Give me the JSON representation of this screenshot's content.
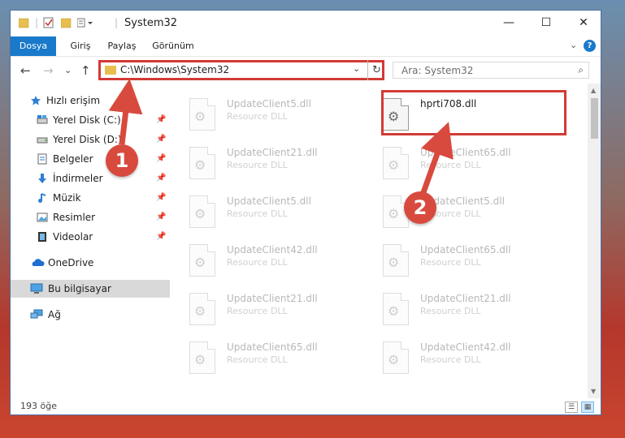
{
  "window": {
    "title": "System32",
    "controls": {
      "minimize": "—",
      "maximize": "☐",
      "close": "✕"
    }
  },
  "ribbon": {
    "tabs": [
      "Dosya",
      "Giriş",
      "Paylaş",
      "Görünüm"
    ],
    "expand_glyph": "⌄",
    "help_glyph": "?"
  },
  "navbar": {
    "back_glyph": "←",
    "forward_glyph": "→",
    "recent_glyph": "⌄",
    "up_glyph": "↑",
    "address": "C:\\Windows\\System32",
    "address_drop_glyph": "⌄",
    "refresh_glyph": "↻",
    "search_placeholder": "Ara: System32",
    "search_glyph": "⌕"
  },
  "sidebar": {
    "items": [
      {
        "label": "Hızlı erişim",
        "icon": "star-icon",
        "pinned": false
      },
      {
        "label": "Yerel Disk (C:)",
        "icon": "drive-icon",
        "pinned": true
      },
      {
        "label": "Yerel Disk (D:)",
        "icon": "drive-icon",
        "pinned": true
      },
      {
        "label": "Belgeler",
        "icon": "documents-icon",
        "pinned": true
      },
      {
        "label": "İndirmeler",
        "icon": "download-icon",
        "pinned": true
      },
      {
        "label": "Müzik",
        "icon": "music-icon",
        "pinned": true
      },
      {
        "label": "Resimler",
        "icon": "pictures-icon",
        "pinned": true
      },
      {
        "label": "Videolar",
        "icon": "videos-icon",
        "pinned": true
      },
      {
        "label": "OneDrive",
        "icon": "cloud-icon",
        "pinned": false
      },
      {
        "label": "Bu bilgisayar",
        "icon": "computer-icon",
        "pinned": false
      },
      {
        "label": "Ağ",
        "icon": "network-icon",
        "pinned": false
      }
    ],
    "pin_glyph": "📌"
  },
  "files": {
    "left_column": [
      {
        "name": "UpdateClient5.dll",
        "desc": "Resource DLL"
      },
      {
        "name": "UpdateClient21.dll",
        "desc": "Resource DLL"
      },
      {
        "name": "UpdateClient5.dll",
        "desc": "Resource DLL"
      },
      {
        "name": "UpdateClient42.dll",
        "desc": "Resource DLL"
      },
      {
        "name": "UpdateClient21.dll",
        "desc": "Resource DLL"
      },
      {
        "name": "UpdateClient65.dll",
        "desc": "Resource DLL"
      }
    ],
    "right_column": [
      {
        "name": "hprti708.dll",
        "desc": ""
      },
      {
        "name": "UpdateClient65.dll",
        "desc": "Resource DLL"
      },
      {
        "name": "UpdateClient5.dll",
        "desc": "Resource DLL"
      },
      {
        "name": "UpdateClient65.dll",
        "desc": "Resource DLL"
      },
      {
        "name": "UpdateClient21.dll",
        "desc": "Resource DLL"
      },
      {
        "name": "UpdateClient42.dll",
        "desc": "Resource DLL"
      }
    ]
  },
  "status": {
    "item_count": "193 öğe"
  },
  "annotations": {
    "marker1": "1",
    "marker2": "2"
  },
  "colors": {
    "accent": "#1979ca",
    "highlight_red": "#d23a35",
    "marker_red": "#d84a3e"
  }
}
